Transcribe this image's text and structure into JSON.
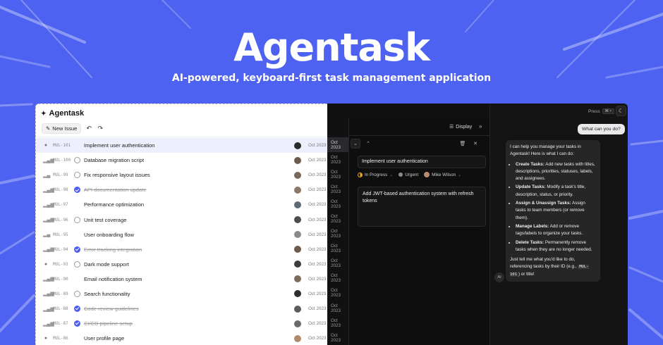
{
  "hero": {
    "title": "Agentask",
    "subtitle": "AI-powered, keyboard-first task management application"
  },
  "colors": {
    "background": "#4d62f0",
    "in_progress": "#f0a316",
    "done": "#4b5ef0",
    "selected_row": "#edeffd"
  },
  "app": {
    "brand": "Agentask",
    "brand_icon": "sparkle-icon",
    "toolbar": {
      "new_issue_label": "New Issue",
      "undo_icon": "undo-icon",
      "redo_icon": "redo-icon"
    },
    "issues": [
      {
        "id": "MUL-101",
        "title": "Implement user authentication",
        "status": "in-progress",
        "priority": "urgent",
        "date": "Oct 2023",
        "selected": true
      },
      {
        "id": "MUL-100",
        "title": "Database migration script",
        "status": "todo",
        "priority": "high",
        "date": "Oct 2023"
      },
      {
        "id": "MUL-99",
        "title": "Fix responsive layout issues",
        "status": "todo",
        "priority": "medium",
        "date": "Oct 2023"
      },
      {
        "id": "MUL-98",
        "title": "API documentation update",
        "status": "done",
        "priority": "high",
        "date": "Oct 2023"
      },
      {
        "id": "MUL-97",
        "title": "Performance optimization",
        "status": "in-progress",
        "priority": "high",
        "date": "Oct 2023"
      },
      {
        "id": "MUL-96",
        "title": "Unit test coverage",
        "status": "todo",
        "priority": "high",
        "date": "Oct 2023"
      },
      {
        "id": "MUL-95",
        "title": "User onboarding flow",
        "status": "in-progress",
        "priority": "medium",
        "date": "Oct 2023"
      },
      {
        "id": "MUL-94",
        "title": "Error tracking integration",
        "status": "done",
        "priority": "high",
        "date": "Oct 2023"
      },
      {
        "id": "MUL-93",
        "title": "Dark mode support",
        "status": "todo",
        "priority": "urgent",
        "date": "Oct 2023"
      },
      {
        "id": "MUL-90",
        "title": "Email notification system",
        "status": "in-progress",
        "priority": "high",
        "date": "Oct 2023"
      },
      {
        "id": "MUL-89",
        "title": "Search functionality",
        "status": "todo",
        "priority": "high",
        "date": "Oct 2023"
      },
      {
        "id": "MUL-88",
        "title": "Code review guidelines",
        "status": "done",
        "priority": "high",
        "date": "Oct 2023"
      },
      {
        "id": "MUL-87",
        "title": "CI/CD pipeline setup",
        "status": "done",
        "priority": "high",
        "date": "Oct 2023"
      },
      {
        "id": "MUL-86",
        "title": "User profile page",
        "status": "in-progress",
        "priority": "urgent",
        "date": "Oct 2023"
      }
    ],
    "detail": {
      "display_label": "Display",
      "title_value": "Implement user authentication",
      "status": "In Progress",
      "priority": "Urgent",
      "assignee": "Mike Wilson",
      "description": "Add JWT-based authentication system with refresh tokens"
    },
    "chat": {
      "press_label": "Press",
      "shortcut": "⌘ •",
      "user_message": "What can you do?",
      "ai_label": "AI",
      "ai_intro": "I can help you manage your tasks in Agentask! Here is what I can do:",
      "capabilities": [
        {
          "name": "Create Tasks:",
          "desc": "Add new tasks with titles, descriptions, priorities, statuses, labels, and assignees."
        },
        {
          "name": "Update Tasks:",
          "desc": "Modify a task's title, description, status, or priority."
        },
        {
          "name": "Assign & Unassign Tasks:",
          "desc": "Assign tasks to team members (or remove them)."
        },
        {
          "name": "Manage Labels:",
          "desc": "Add or remove tags/labels to organize your tasks."
        },
        {
          "name": "Delete Tasks:",
          "desc": "Permanently remove tasks when they are no longer needed."
        }
      ],
      "ai_outro_before": "Just tell me what you'd like to do, referencing tasks by their ID (e.g.,",
      "ai_outro_code": "MUL-101",
      "ai_outro_after": ") or title!"
    }
  }
}
